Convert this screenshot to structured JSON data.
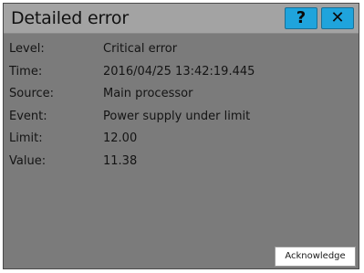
{
  "window": {
    "title": "Detailed error",
    "help_label": "?",
    "close_label": "✕"
  },
  "details": [
    {
      "label": "Level:",
      "value": "Critical error"
    },
    {
      "label": "Time:",
      "value": "2016/04/25 13:42:19.445"
    },
    {
      "label": "Source:",
      "value": "Main processor"
    },
    {
      "label": "Event:",
      "value": "Power supply under limit"
    },
    {
      "label": "Limit:",
      "value": "12.00"
    },
    {
      "label": "Value:",
      "value": "11.38"
    }
  ],
  "actions": {
    "acknowledge_label": "Acknowledge"
  },
  "colors": {
    "title_button_blue": "#1fa4dc",
    "dialog_background": "#7b7b7b",
    "titlebar_background": "#a3a3a3"
  },
  "icons": {
    "help": "help-icon",
    "close": "close-icon"
  }
}
